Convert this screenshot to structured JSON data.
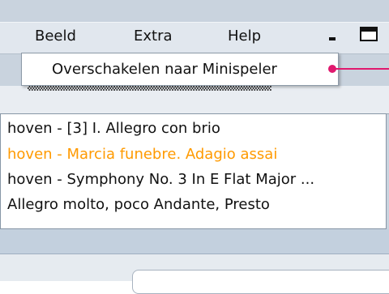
{
  "menubar": {
    "items": [
      {
        "label": "Beeld"
      },
      {
        "label": "Extra"
      },
      {
        "label": "Help"
      }
    ]
  },
  "dropdown": {
    "item_label": "Overschakelen naar Minispeler"
  },
  "tracklist": {
    "rows": [
      {
        "text": "hoven - [3] I. Allegro con brio",
        "state": "normal"
      },
      {
        "text": "hoven - Marcia funebre. Adagio assai",
        "state": "playing"
      },
      {
        "text": "hoven - Symphony No. 3 In E Flat Major ...",
        "state": "normal"
      },
      {
        "text": "Allegro molto, poco Andante, Presto",
        "state": "normal"
      }
    ]
  },
  "colors": {
    "playing_track": "#ff9a00",
    "callout_line": "#e0196e",
    "menubar_bg": "#e1e7ee",
    "panel_bg": "#c3d0de"
  },
  "icons": {
    "minimize": "minimize-icon",
    "maximize": "maximize-icon"
  }
}
